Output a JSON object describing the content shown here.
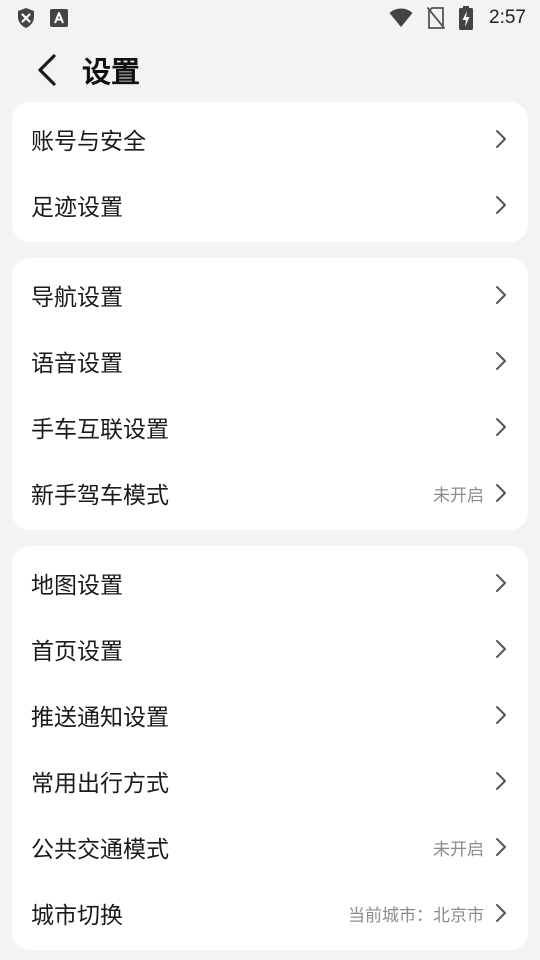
{
  "status_bar": {
    "time": "2:57",
    "left_icons": [
      "shield-x-icon",
      "font-a-icon"
    ],
    "right_icons": [
      "wifi-icon",
      "no-sim-icon",
      "battery-charging-icon"
    ]
  },
  "header": {
    "title": "设置"
  },
  "groups": [
    {
      "items": [
        {
          "label": "账号与安全",
          "value": ""
        },
        {
          "label": "足迹设置",
          "value": ""
        }
      ]
    },
    {
      "items": [
        {
          "label": "导航设置",
          "value": ""
        },
        {
          "label": "语音设置",
          "value": ""
        },
        {
          "label": "手车互联设置",
          "value": ""
        },
        {
          "label": "新手驾车模式",
          "value": "未开启"
        }
      ]
    },
    {
      "items": [
        {
          "label": "地图设置",
          "value": ""
        },
        {
          "label": "首页设置",
          "value": ""
        },
        {
          "label": "推送通知设置",
          "value": ""
        },
        {
          "label": "常用出行方式",
          "value": ""
        },
        {
          "label": "公共交通模式",
          "value": "未开启"
        },
        {
          "label": "城市切换",
          "value": "当前城市：北京市"
        }
      ]
    }
  ],
  "colors": {
    "background": "#f2f3f5",
    "card": "#ffffff",
    "secondary_text": "#8c8c8c"
  }
}
